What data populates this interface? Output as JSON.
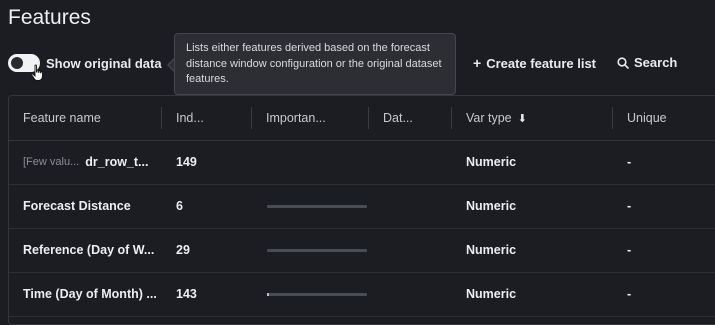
{
  "page": {
    "title": "Features"
  },
  "toggle": {
    "label": "Show original data",
    "on": false
  },
  "tooltip": {
    "text": "Lists either features derived based on the forecast distance window configuration or the original dataset features."
  },
  "toolbar": {
    "create_icon": "+",
    "create_label": "Create feature list",
    "search_icon": "search-icon",
    "search_label": "Search"
  },
  "table": {
    "columns": [
      {
        "label": "Feature name"
      },
      {
        "label": "Ind..."
      },
      {
        "label": "Importan..."
      },
      {
        "label": "Dat..."
      },
      {
        "label": "Var type",
        "sort_icon": "⬇"
      },
      {
        "label": "Unique"
      }
    ],
    "rows": [
      {
        "prefix": "[Few valu...",
        "name": "dr_row_t...",
        "index": "149",
        "importance": 0.0,
        "var_type": "Numeric",
        "unique": "-"
      },
      {
        "prefix": "",
        "name": "Forecast Distance",
        "index": "6",
        "importance": 0.0,
        "var_type": "Numeric",
        "unique": "-"
      },
      {
        "prefix": "",
        "name": "Reference (Day of W...",
        "index": "29",
        "importance": 0.0,
        "var_type": "Numeric",
        "unique": "-"
      },
      {
        "prefix": "",
        "name": "Time (Day of Month) ...",
        "index": "143",
        "importance": 0.02,
        "var_type": "Numeric",
        "unique": "-"
      }
    ]
  },
  "colors": {
    "background": "#1c1d22",
    "tooltip_bg": "#2c2e34",
    "border": "#34363c"
  }
}
